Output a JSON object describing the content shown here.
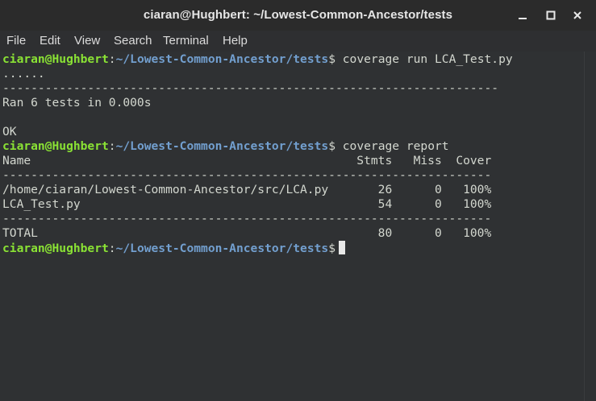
{
  "window": {
    "title": "ciaran@Hughbert: ~/Lowest-Common-Ancestor/tests",
    "controls": {
      "minimize": "minimize-icon",
      "maximize": "maximize-icon",
      "close": "close-icon"
    }
  },
  "menu": [
    "File",
    "Edit",
    "View",
    "Search",
    "Terminal",
    "Help"
  ],
  "prompt": {
    "user_host": "ciaran@Hughbert",
    "colon": ":",
    "path": "~/Lowest-Common-Ancestor/tests",
    "symbol": "$"
  },
  "lines": {
    "l1_cmd": " coverage run LCA_Test.py",
    "l2": "......",
    "l3": "----------------------------------------------------------------------",
    "l4": "Ran 6 tests in 0.000s",
    "l5": "",
    "l6": "OK",
    "l7_cmd": " coverage report",
    "l8": "Name                                              Stmts   Miss  Cover",
    "l9": "---------------------------------------------------------------------",
    "l10": "/home/ciaran/Lowest-Common-Ancestor/src/LCA.py       26      0   100%",
    "l11": "LCA_Test.py                                          54      0   100%",
    "l12": "---------------------------------------------------------------------",
    "l13": "TOTAL                                                80      0   100%"
  },
  "colors": {
    "background": "#2f3133",
    "text": "#d3d7cf",
    "user_host": "#8ae234",
    "path": "#729fcf"
  }
}
